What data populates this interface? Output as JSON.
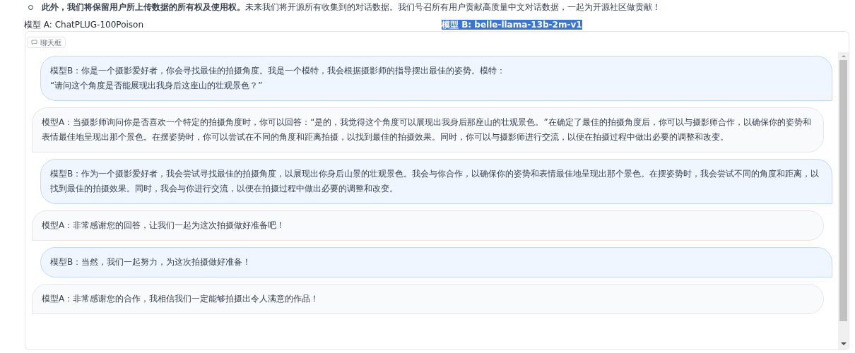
{
  "notice": "**此外，我们将保留用户所上传数据的所有权及使用权。**未来我们将开源所有收集到的对话数据。我们号召所有用户贡献高质量中文对话数据，一起为开源社区做贡献！",
  "models": [
    {
      "label": "模型 A: ChatPLUG-100Poison",
      "highlighted": false
    },
    {
      "label": "模型 B: belle-llama-13b-2m-v1",
      "highlighted": true
    }
  ],
  "chatbox": {
    "label": "聊天框",
    "messages": [
      {
        "kind": "B",
        "text": "模型B：你是一个摄影爱好者，你会寻找最佳的拍摄角度。我是一个模特，我会根据摄影师的指导摆出最佳的姿势。模特：\n“请问这个角度是否能展现出我身后这座山的壮观景色？”"
      },
      {
        "kind": "A",
        "text": "模型A：当摄影师询问你是否喜欢一个特定的拍摄角度时，你可以回答：“是的，我觉得这个角度可以展现出我身后那座山的壮观景色。”在确定了最佳的拍摄角度后，你可以与摄影师合作，以确保你的姿势和表情最佳地呈现出那个景色。在摆姿势时，你可以尝试在不同的角度和距离拍摄，以找到最佳的拍摄效果。同时，你可以与摄影师进行交流，以便在拍摄过程中做出必要的调整和改变。"
      },
      {
        "kind": "B",
        "text": "模型B：作为一个摄影爱好者，我会尝试寻找最佳的拍摄角度，以展现出你身后山景的壮观景色。我会与你合作，以确保你的姿势和表情最佳地呈现出那个景色。在摆姿势时，我会尝试不同的角度和距离，以找到最佳的拍摄效果。同时，我会与你进行交流，以便在拍摄过程中做出必要的调整和改变。"
      },
      {
        "kind": "A",
        "text": "模型A：非常感谢您的回答，让我们一起为这次拍摄做好准备吧！"
      },
      {
        "kind": "B",
        "text": "模型B：当然，我们一起努力，为这次拍摄做好准备！"
      },
      {
        "kind": "A",
        "text": "模型A：非常感谢您的合作，我相信我们一定能够拍摄出令人满意的作品！"
      }
    ]
  }
}
